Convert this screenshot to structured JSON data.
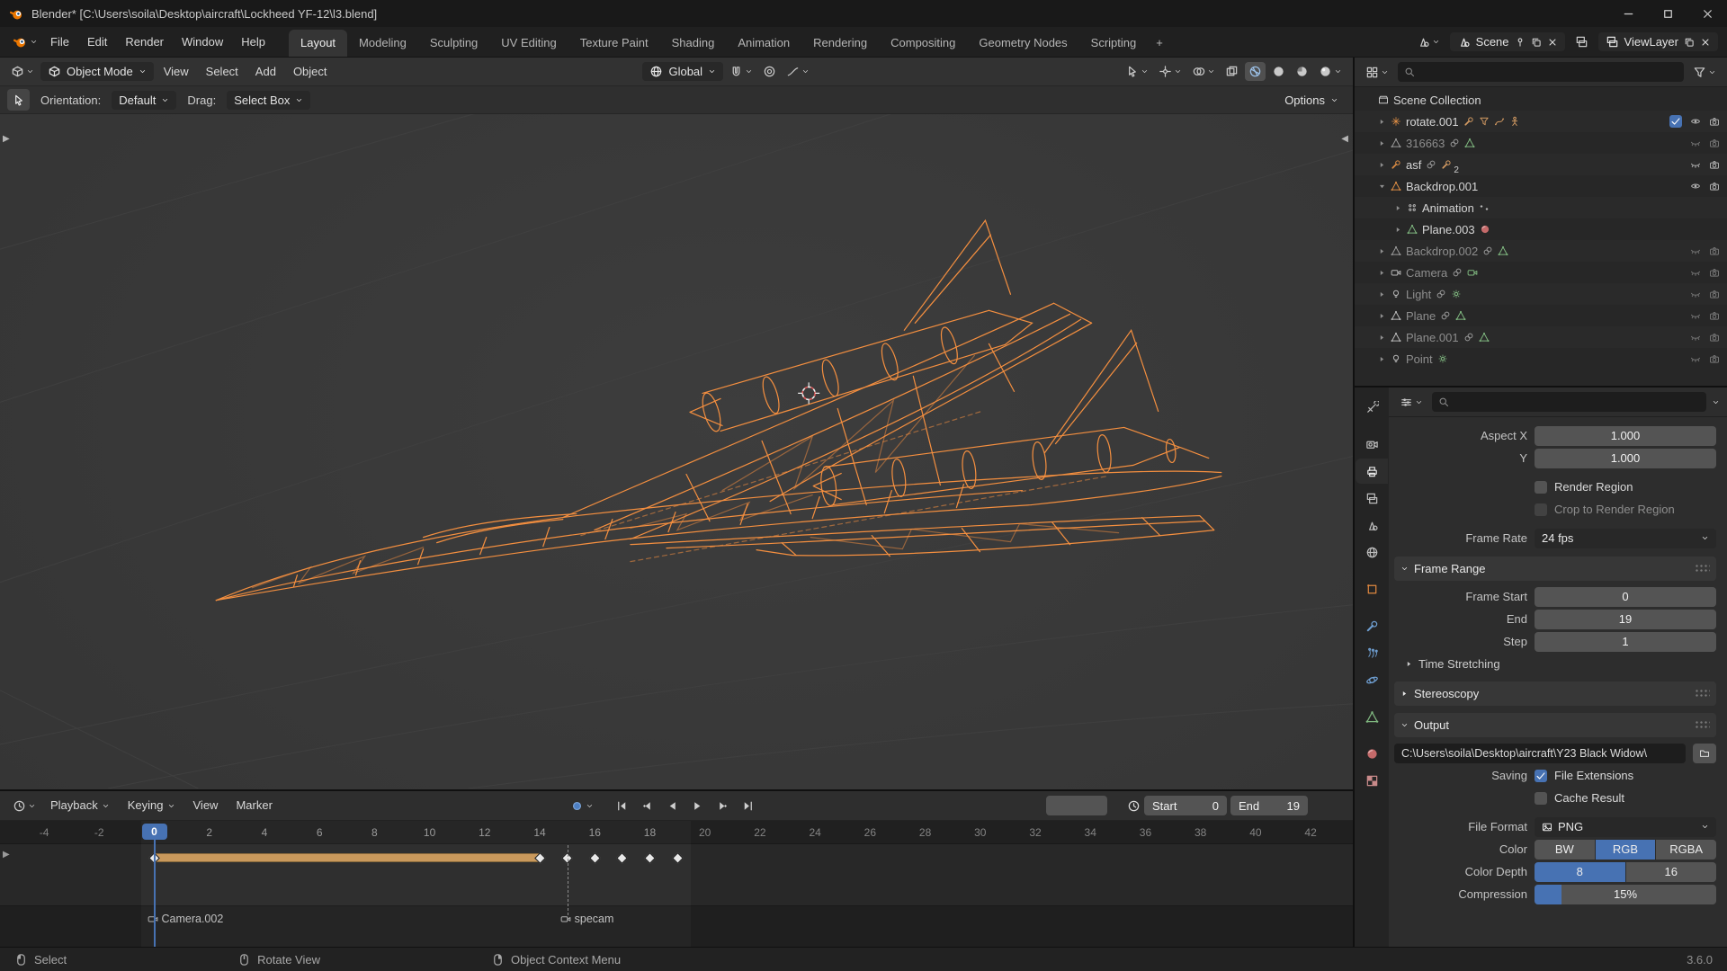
{
  "window": {
    "title": "Blender* [C:\\Users\\soila\\Desktop\\aircraft\\Lockheed YF-12\\l3.blend]"
  },
  "topbar": {
    "menus": [
      "File",
      "Edit",
      "Render",
      "Window",
      "Help"
    ],
    "workspaces": [
      "Layout",
      "Modeling",
      "Sculpting",
      "UV Editing",
      "Texture Paint",
      "Shading",
      "Animation",
      "Rendering",
      "Compositing",
      "Geometry Nodes",
      "Scripting"
    ],
    "active_workspace": "Layout",
    "new_workspace_button": "+",
    "scene": {
      "label": "Scene"
    },
    "view_layer": {
      "label": "ViewLayer"
    }
  },
  "viewport": {
    "mode": "Object Mode",
    "menus": [
      "View",
      "Select",
      "Add",
      "Object"
    ],
    "orientation": "Global",
    "tool_settings": {
      "orientation_label": "Orientation:",
      "orientation_value": "Default",
      "drag_label": "Drag:",
      "drag_value": "Select Box",
      "options_label": "Options"
    }
  },
  "outliner": {
    "rows": [
      {
        "label": "Scene Collection",
        "indent": 0,
        "arrow": null,
        "icon": "collection",
        "icon_color": "#c9c9c9",
        "trailing": [],
        "right": [],
        "dim": false
      },
      {
        "label": "rotate.001",
        "indent": 1,
        "arrow": "right",
        "icon": "empty-axes",
        "icon_color": "#dd8d44",
        "trailing": [
          [
            "wrench",
            "#d29a62"
          ],
          [
            "funnel",
            "#d29a62"
          ],
          [
            "curve",
            "#d29a62"
          ],
          [
            "armature",
            "#d29a62"
          ]
        ],
        "right": [
          "checkbox",
          "eye-open",
          "camera-restrict"
        ],
        "dim": false
      },
      {
        "label": "316663",
        "indent": 1,
        "arrow": "right",
        "icon": "mesh",
        "icon_color": "#9a9a9a",
        "trailing": [
          [
            "link",
            "#9a9a9a"
          ],
          [
            "mesh",
            "#7fb77f"
          ]
        ],
        "right": [
          "eye-closed",
          "camera-restrict"
        ],
        "dim": true
      },
      {
        "label": "asf",
        "indent": 1,
        "arrow": "right",
        "icon": "wrench",
        "icon_color": "#dd8d44",
        "trailing": [
          [
            "link",
            "#9a9a9a"
          ],
          [
            "wrench",
            "#d29a62"
          ]
        ],
        "badge": "2",
        "right": [
          "eye-closed",
          "camera-restrict"
        ],
        "dim": false
      },
      {
        "label": "Backdrop.001",
        "indent": 1,
        "arrow": "down",
        "icon": "mesh",
        "icon_color": "#dd8d44",
        "trailing": [],
        "right": [
          "eye-open",
          "camera-restrict"
        ],
        "dim": false
      },
      {
        "label": "Animation",
        "indent": 2,
        "arrow": "right",
        "icon": "action",
        "icon_color": "#b9b9b9",
        "trailing": [
          [
            "dopesheet",
            "#b9b9b9"
          ]
        ],
        "right": [],
        "dim": false
      },
      {
        "label": "Plane.003",
        "indent": 2,
        "arrow": "right",
        "icon": "mesh",
        "icon_color": "#7fb77f",
        "trailing": [
          [
            "mat-sphere",
            "#c56a6a"
          ]
        ],
        "right": [],
        "dim": false
      },
      {
        "label": "Backdrop.002",
        "indent": 1,
        "arrow": "right",
        "icon": "mesh",
        "icon_color": "#9a9a9a",
        "trailing": [
          [
            "link",
            "#9a9a9a"
          ],
          [
            "mesh",
            "#7fb77f"
          ]
        ],
        "right": [
          "eye-closed",
          "camera-restrict"
        ],
        "dim": true
      },
      {
        "label": "Camera",
        "indent": 1,
        "arrow": "right",
        "icon": "camera-obj",
        "icon_color": "#b9b9b9",
        "trailing": [
          [
            "link",
            "#9a9a9a"
          ],
          [
            "camera-obj",
            "#7fb77f"
          ]
        ],
        "right": [
          "eye-closed",
          "camera-restrict"
        ],
        "dim": true
      },
      {
        "label": "Light",
        "indent": 1,
        "arrow": "right",
        "icon": "light",
        "icon_color": "#b9b9b9",
        "trailing": [
          [
            "link",
            "#9a9a9a"
          ],
          [
            "light-point",
            "#7fb77f"
          ]
        ],
        "right": [
          "eye-closed",
          "camera-restrict"
        ],
        "dim": true
      },
      {
        "label": "Plane",
        "indent": 1,
        "arrow": "right",
        "icon": "mesh",
        "icon_color": "#b9b9b9",
        "trailing": [
          [
            "link",
            "#9a9a9a"
          ],
          [
            "mesh",
            "#7fb77f"
          ]
        ],
        "right": [
          "eye-closed",
          "camera-restrict"
        ],
        "dim": true
      },
      {
        "label": "Plane.001",
        "indent": 1,
        "arrow": "right",
        "icon": "mesh",
        "icon_color": "#b9b9b9",
        "trailing": [
          [
            "link",
            "#9a9a9a"
          ],
          [
            "mesh",
            "#7fb77f"
          ]
        ],
        "right": [
          "eye-closed",
          "camera-restrict"
        ],
        "dim": true
      },
      {
        "label": "Point",
        "indent": 1,
        "arrow": "right",
        "icon": "light",
        "icon_color": "#b9b9b9",
        "trailing": [
          [
            "light-point",
            "#7fb77f"
          ]
        ],
        "right": [
          "eye-closed",
          "camera-restrict"
        ],
        "dim": true
      }
    ]
  },
  "properties": {
    "tabs": [
      {
        "name": "tool",
        "icon": "tool",
        "color": "#bdbdbd"
      },
      {
        "name": "render",
        "icon": "render-cam",
        "color": "#bdbdbd",
        "gap": true
      },
      {
        "name": "output",
        "icon": "printer",
        "color": "#e8e8e8",
        "active": true
      },
      {
        "name": "view-layer",
        "icon": "view-layer",
        "color": "#bdbdbd"
      },
      {
        "name": "scene",
        "icon": "scene-props",
        "color": "#bdbdbd"
      },
      {
        "name": "world",
        "icon": "world",
        "color": "#bdbdbd"
      },
      {
        "name": "object",
        "icon": "object-props",
        "color": "#e0883f",
        "gap": true
      },
      {
        "name": "modifiers",
        "icon": "wrench",
        "color": "#6f9fd2",
        "gap": true
      },
      {
        "name": "particles",
        "icon": "particles",
        "color": "#6f9fd2"
      },
      {
        "name": "physics",
        "icon": "physics",
        "color": "#6f9fd2"
      },
      {
        "name": "object-data",
        "icon": "mesh",
        "color": "#7fb77f",
        "gap": true
      },
      {
        "name": "material",
        "icon": "mat-sphere",
        "color": "#c56a6a",
        "gap": true
      },
      {
        "name": "texture",
        "icon": "checker",
        "color": "#c98a8a"
      }
    ],
    "content": [
      {
        "type": "field",
        "label": "Aspect X",
        "value": "1.000"
      },
      {
        "type": "field",
        "label": "Y",
        "value": "1.000"
      },
      {
        "type": "gap"
      },
      {
        "type": "check",
        "label": "",
        "text": "Render Region",
        "checked": false
      },
      {
        "type": "check",
        "label": "",
        "text": "Crop to Render Region",
        "checked": false,
        "dim": true
      },
      {
        "type": "gap"
      },
      {
        "type": "dropdown",
        "label": "Frame Rate",
        "value": "24 fps"
      },
      {
        "type": "section",
        "label": "Frame Range",
        "open": true
      },
      {
        "type": "field",
        "label": "Frame Start",
        "value": "0"
      },
      {
        "type": "field",
        "label": "End",
        "value": "19"
      },
      {
        "type": "field",
        "label": "Step",
        "value": "1"
      },
      {
        "type": "subsection",
        "label": "Time Stretching"
      },
      {
        "type": "section",
        "label": "Stereoscopy",
        "open": false
      },
      {
        "type": "section",
        "label": "Output",
        "open": true
      },
      {
        "type": "path",
        "value": "C:\\Users\\soila\\Desktop\\aircraft\\Y23 Black Widow\\"
      },
      {
        "type": "check",
        "label": "Saving",
        "text": "File Extensions",
        "checked": true
      },
      {
        "type": "check",
        "label": "",
        "text": "Cache Result",
        "checked": false
      },
      {
        "type": "gap"
      },
      {
        "type": "dropdown",
        "label": "File Format",
        "value": "PNG",
        "icon": "image"
      },
      {
        "type": "segmented",
        "label": "Color",
        "options": [
          "BW",
          "RGB",
          "RGBA"
        ],
        "active": "RGB"
      },
      {
        "type": "segmented",
        "label": "Color Depth",
        "options": [
          "8",
          "16"
        ],
        "active": "8"
      },
      {
        "type": "slider",
        "label": "Compression",
        "value": "15%",
        "percent": 15
      }
    ]
  },
  "timeline": {
    "menus": [
      {
        "label": "Playback",
        "popover": true
      },
      {
        "label": "Keying",
        "popover": true
      },
      {
        "label": "View",
        "popover": false
      },
      {
        "label": "Marker",
        "popover": false
      }
    ],
    "current_frame": 0,
    "start": {
      "label": "Start",
      "value": 0
    },
    "end": {
      "label": "End",
      "value": 19
    },
    "ruler": {
      "min": -4,
      "max": 42,
      "step": 2
    },
    "keyframe_bar": {
      "from": 0,
      "to": 14
    },
    "keyframes": [
      0,
      14,
      15,
      16,
      17,
      18,
      19
    ],
    "markers": [
      {
        "frame": 0,
        "label": "Camera.002"
      },
      {
        "frame": 15,
        "label": "specam"
      }
    ]
  },
  "statusbar": {
    "hints": [
      {
        "icon": "mouse-left",
        "label": "Select"
      },
      {
        "icon": "mouse-middle",
        "label": "Rotate View"
      },
      {
        "icon": "mouse-right",
        "label": "Object Context Menu"
      }
    ],
    "version": "3.6.0"
  },
  "colors": {
    "accent": "#4772b3",
    "selection_wire": "#ff9440",
    "keyframe_range": "#c9995c"
  }
}
